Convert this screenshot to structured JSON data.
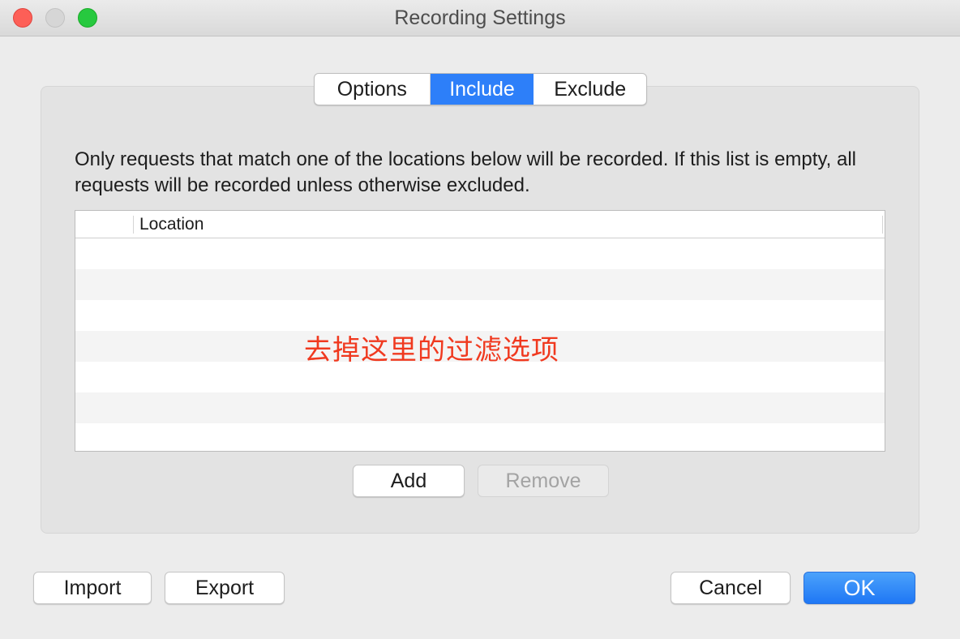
{
  "window": {
    "title": "Recording Settings"
  },
  "tabs": [
    {
      "label": "Options",
      "selected": false
    },
    {
      "label": "Include",
      "selected": true
    },
    {
      "label": "Exclude",
      "selected": false
    }
  ],
  "include_panel": {
    "description": "Only requests that match one of the locations below will be recorded. If this list is empty, all requests will be recorded unless otherwise excluded.",
    "table": {
      "columns": [
        "",
        "Location"
      ],
      "rows": []
    },
    "add_label": "Add",
    "remove_label": "Remove"
  },
  "annotation": {
    "text": "去掉这里的过滤选项",
    "color": "#f0391f"
  },
  "footer": {
    "import_label": "Import",
    "export_label": "Export",
    "cancel_label": "Cancel",
    "ok_label": "OK"
  },
  "colors": {
    "accent": "#2d7ff9",
    "close": "#fd5f57",
    "zoom": "#27c93f"
  }
}
